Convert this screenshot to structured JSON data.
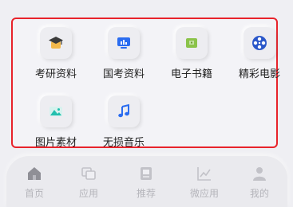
{
  "apps": [
    {
      "label": "考研资料",
      "icon": "graduation-cap-icon"
    },
    {
      "label": "国考资料",
      "icon": "chart-screen-icon"
    },
    {
      "label": "电子书籍",
      "icon": "ebook-icon"
    },
    {
      "label": "精彩电影",
      "icon": "film-reel-icon"
    },
    {
      "label": "图片素材",
      "icon": "image-icon"
    },
    {
      "label": "无损音乐",
      "icon": "music-note-icon"
    }
  ],
  "tabs": [
    {
      "label": "首页",
      "icon": "home-icon"
    },
    {
      "label": "应用",
      "icon": "apps-icon"
    },
    {
      "label": "推荐",
      "icon": "recommend-icon"
    },
    {
      "label": "微应用",
      "icon": "trend-chart-icon"
    },
    {
      "label": "我的",
      "icon": "user-icon"
    }
  ],
  "colors": {
    "highlight_border": "#e8232b",
    "background": "#efeff3",
    "tab_inactive": "#b5b5bb"
  }
}
